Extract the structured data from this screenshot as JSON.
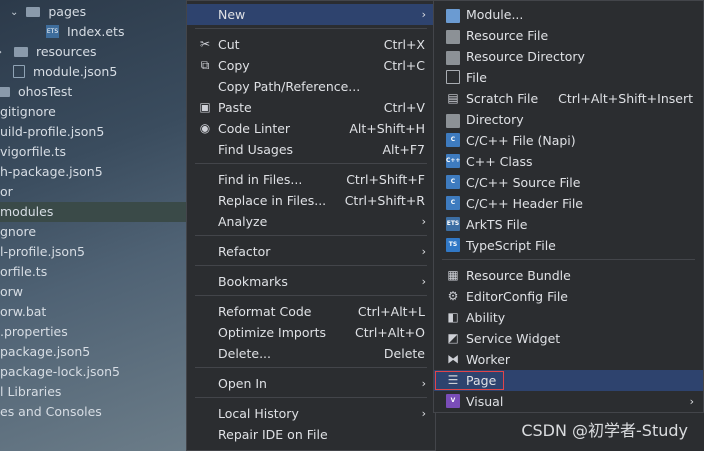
{
  "tree": {
    "rows": [
      {
        "label": "pages",
        "icon": "folder-icon",
        "indent": 1
      },
      {
        "label": "Index.ets",
        "icon": "ets-file-icon",
        "indent": 2
      },
      {
        "label": "resources",
        "icon": "folder-icon",
        "indent": 0
      },
      {
        "label": "module.json5",
        "icon": "json-file-icon",
        "indent": 0
      },
      {
        "label": "ohosTest",
        "icon": "folder-icon",
        "indent": -1
      },
      {
        "label": "gitignore",
        "icon": "",
        "indent": -2
      },
      {
        "label": "uild-profile.json5",
        "icon": "",
        "indent": -2
      },
      {
        "label": "vigorfile.ts",
        "icon": "",
        "indent": -2
      },
      {
        "label": "h-package.json5",
        "icon": "",
        "indent": -2
      },
      {
        "label": "or",
        "icon": "",
        "indent": -2
      },
      {
        "label": "modules",
        "icon": "",
        "indent": -2
      },
      {
        "label": "gnore",
        "icon": "",
        "indent": -2
      },
      {
        "label": "l-profile.json5",
        "icon": "",
        "indent": -2
      },
      {
        "label": "orfile.ts",
        "icon": "",
        "indent": -2
      },
      {
        "label": "orw",
        "icon": "",
        "indent": -2
      },
      {
        "label": "orw.bat",
        "icon": "",
        "indent": -2
      },
      {
        "label": ".properties",
        "icon": "",
        "indent": -2
      },
      {
        "label": "package.json5",
        "icon": "",
        "indent": -2
      },
      {
        "label": "package-lock.json5",
        "icon": "",
        "indent": -2
      },
      {
        "label": "l Libraries",
        "icon": "",
        "indent": -2
      },
      {
        "label": "es and Consoles",
        "icon": "",
        "indent": -2
      }
    ]
  },
  "context_menu": {
    "items": [
      {
        "label": "New",
        "shortcut": "",
        "submenu": true
      },
      {
        "label": "Cut",
        "shortcut": "Ctrl+X"
      },
      {
        "label": "Copy",
        "shortcut": "Ctrl+C"
      },
      {
        "label": "Copy Path/Reference...",
        "shortcut": ""
      },
      {
        "label": "Paste",
        "shortcut": "Ctrl+V"
      },
      {
        "label": "Code Linter",
        "shortcut": "Alt+Shift+H"
      },
      {
        "label": "Find Usages",
        "shortcut": "Alt+F7"
      },
      {
        "label": "Find in Files...",
        "shortcut": "Ctrl+Shift+F"
      },
      {
        "label": "Replace in Files...",
        "shortcut": "Ctrl+Shift+R"
      },
      {
        "label": "Analyze",
        "shortcut": "",
        "submenu": true
      },
      {
        "label": "Refactor",
        "shortcut": "",
        "submenu": true
      },
      {
        "label": "Bookmarks",
        "shortcut": "",
        "submenu": true
      },
      {
        "label": "Reformat Code",
        "shortcut": "Ctrl+Alt+L"
      },
      {
        "label": "Optimize Imports",
        "shortcut": "Ctrl+Alt+O"
      },
      {
        "label": "Delete...",
        "shortcut": "Delete"
      },
      {
        "label": "Open In",
        "shortcut": "",
        "submenu": true
      },
      {
        "label": "Local History",
        "shortcut": "",
        "submenu": true
      },
      {
        "label": "Repair IDE on File",
        "shortcut": ""
      }
    ]
  },
  "new_submenu": {
    "items": [
      {
        "label": "Module...",
        "shortcut": ""
      },
      {
        "label": "Resource File",
        "shortcut": ""
      },
      {
        "label": "Resource Directory",
        "shortcut": ""
      },
      {
        "label": "File",
        "shortcut": ""
      },
      {
        "label": "Scratch File",
        "shortcut": "Ctrl+Alt+Shift+Insert"
      },
      {
        "label": "Directory",
        "shortcut": ""
      },
      {
        "label": "C/C++ File (Napi)",
        "shortcut": ""
      },
      {
        "label": "C++ Class",
        "shortcut": ""
      },
      {
        "label": "C/C++ Source File",
        "shortcut": ""
      },
      {
        "label": "C/C++ Header File",
        "shortcut": ""
      },
      {
        "label": "ArkTS File",
        "shortcut": ""
      },
      {
        "label": "TypeScript File",
        "shortcut": ""
      },
      {
        "label": "Resource Bundle",
        "shortcut": ""
      },
      {
        "label": "EditorConfig File",
        "shortcut": ""
      },
      {
        "label": "Ability",
        "shortcut": ""
      },
      {
        "label": "Service Widget",
        "shortcut": ""
      },
      {
        "label": "Worker",
        "shortcut": ""
      },
      {
        "label": "Page",
        "shortcut": ""
      },
      {
        "label": "Visual",
        "shortcut": "",
        "submenu": true
      }
    ],
    "badges": {
      "c": "C",
      "cpp": "C++",
      "ets": "ETS",
      "ts": "TS",
      "v": "V"
    }
  },
  "watermark": "CSDN @初学者-Study",
  "colors": {
    "highlight": "#2e436e",
    "page_box": "#e0454a",
    "menu_bg": "#2b2d30"
  }
}
